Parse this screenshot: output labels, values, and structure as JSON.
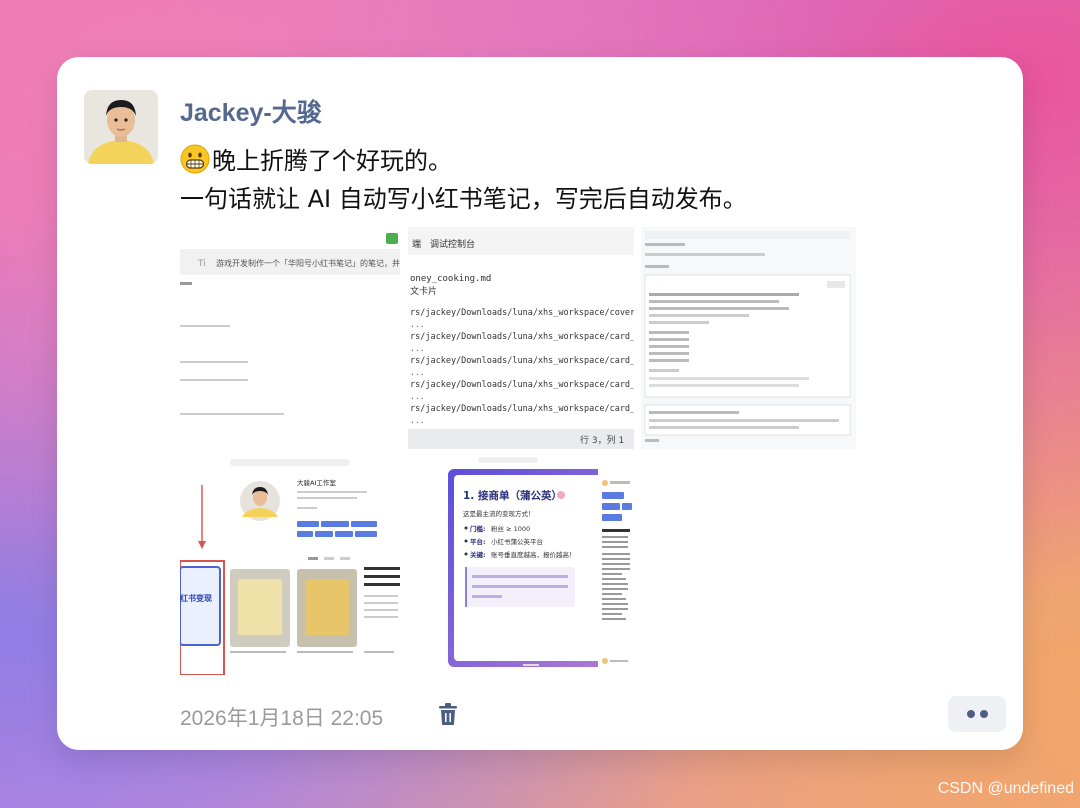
{
  "post": {
    "username": "Jackey-大骏",
    "line1": "晚上折腾了个好玩的。",
    "line2": "一句话就让 AI 自动写小红书笔记，写完后自动发布。",
    "emoji_icon": "grinning-face-icon",
    "timestamp": "2026年1月18日 22:05"
  },
  "thumb1": {
    "prompt": "游戏开发制作一个「华阳号小红书笔记」的笔记，并发"
  },
  "thumb2": {
    "tab": "调试控制台",
    "file": "oney_cooking.md",
    "sub": "文卡片",
    "paths": [
      "rs/jackey/Downloads/luna/xhs_workspace/cover.p",
      "rs/jackey/Downloads/luna/xhs_workspace/card_1.",
      "rs/jackey/Downloads/luna/xhs_workspace/card_2.",
      "rs/jackey/Downloads/luna/xhs_workspace/card_3.",
      "rs/jackey/Downloads/luna/xhs_workspace/card_4."
    ],
    "status": "行 3，列 1"
  },
  "thumb4": {
    "studio_name": "大骏AI工作室",
    "card_title": "红书变现"
  },
  "thumb5": {
    "title": "1. 接商单（蒲公英）",
    "subtitle": "这是最主流的变现方式！",
    "bullets": [
      {
        "label": "门槛:",
        "value": "粉丝 ≥ 1000"
      },
      {
        "label": "平台:",
        "value": "小红书蒲公英平台"
      },
      {
        "label": "关键:",
        "value": "账号垂直度越高，报价越高！"
      }
    ]
  },
  "watermark": "CSDN @undefined"
}
